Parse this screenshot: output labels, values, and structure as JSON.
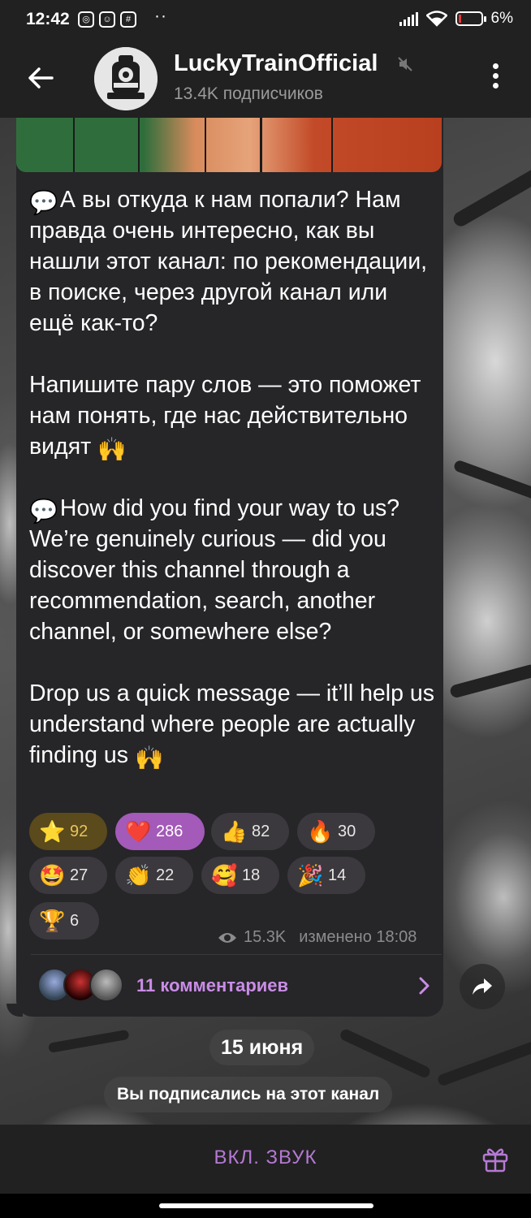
{
  "status_bar": {
    "time": "12:42",
    "battery": "6%",
    "dots": "··"
  },
  "header": {
    "channel_name": "LuckyTrainOfficial",
    "subscribers": "13.4K подписчиков",
    "icons": [
      "back-arrow-icon",
      "muted-icon",
      "more-vert-icon"
    ]
  },
  "message": {
    "paragraph_ru_1": "А вы откуда к нам попали? Нам правда очень интересно, как вы нашли этот канал: по рекомендации, в поиске, через другой канал или ещё как-то?",
    "paragraph_ru_2": "Напишите пару слов — это поможет нам понять, где нас действительно видят",
    "paragraph_en_1_a": "How did you find your way to us?",
    "paragraph_en_1_b": "We’re genuinely curious — did you discover this channel through a recommendation, search, another channel, or somewhere else?",
    "paragraph_en_2": "Drop us a quick message — it’ll help us understand where people are actually finding us",
    "speech_emoji": "💬",
    "raised_hands_emoji": "🙌",
    "reactions": [
      {
        "emoji": "⭐",
        "count": "92"
      },
      {
        "emoji": "❤️",
        "count": "286"
      },
      {
        "emoji": "👍",
        "count": "82"
      },
      {
        "emoji": "🔥",
        "count": "30"
      },
      {
        "emoji": "🤩",
        "count": "27"
      },
      {
        "emoji": "👏",
        "count": "22"
      },
      {
        "emoji": "🥰",
        "count": "18"
      },
      {
        "emoji": "🎉",
        "count": "14"
      },
      {
        "emoji": "🏆",
        "count": "6"
      }
    ],
    "views": "15.3K",
    "edited": "изменено 18:08",
    "comments": "11 комментариев"
  },
  "date_separator": "15 июня",
  "service_message": "Вы подписались на этот канал",
  "bottom": {
    "sound_button": "ВКЛ. ЗВУК"
  },
  "colors": {
    "accent": "#b579d3",
    "bubble": "#262528",
    "bar": "#212121"
  }
}
